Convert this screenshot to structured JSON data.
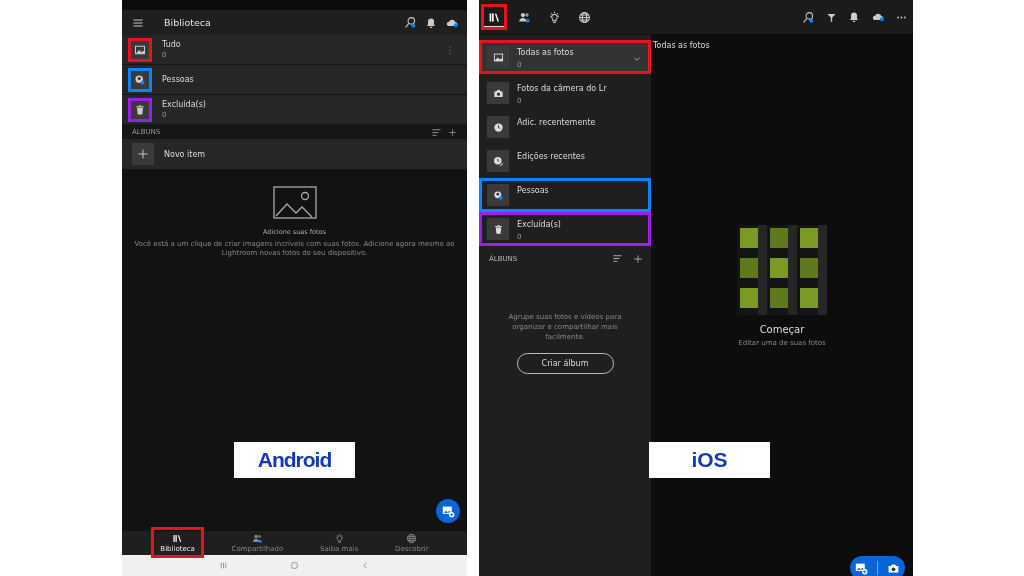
{
  "android": {
    "app_bar": {
      "title": "Biblioteca"
    },
    "items": [
      {
        "kind": "all",
        "label": "Tudo",
        "count": "0",
        "color": "#e8141c"
      },
      {
        "kind": "people",
        "label": "Pessoas",
        "color": "#0a84ff"
      },
      {
        "kind": "deleted",
        "label": "Excluída(s)",
        "count": "0",
        "color": "#9b1fe8"
      }
    ],
    "albums_header": "ÁLBUNS",
    "new_item": "Novo item",
    "empty_state": {
      "title": "Adicione suas fotos",
      "text": "Você está a um clique de criar imagens incríveis com suas fotos. Adicione agora mesmo ao Lightroom novas fotos do seu dispositivo."
    },
    "caption": "Android",
    "bottom_nav": [
      {
        "kind": "library",
        "label": "Biblioteca",
        "selected": true,
        "color": "#e8141c"
      },
      {
        "kind": "shared",
        "label": "Compartilhado",
        "selected": false
      },
      {
        "kind": "learn",
        "label": "Saiba mais",
        "selected": false
      },
      {
        "kind": "discover",
        "label": "Descobrir",
        "selected": false
      }
    ]
  },
  "ios": {
    "tabs": [
      {
        "kind": "library",
        "selected": true,
        "color": "#e8141c"
      },
      {
        "kind": "shared",
        "selected": false
      },
      {
        "kind": "learn",
        "selected": false
      },
      {
        "kind": "discover",
        "selected": false
      }
    ],
    "sidebar": [
      {
        "kind": "all",
        "label": "Todas as fotos",
        "count": "0",
        "selected": true,
        "color": "#e8141c"
      },
      {
        "kind": "camera",
        "label": "Fotos da câmera do Lr",
        "count": "0",
        "selected": false
      },
      {
        "kind": "recent",
        "label": "Adic. recentemente",
        "selected": false
      },
      {
        "kind": "edits",
        "label": "Edições recentes",
        "selected": false
      },
      {
        "kind": "people",
        "label": "Pessoas",
        "selected": false,
        "color": "#0a84ff"
      },
      {
        "kind": "deleted",
        "label": "Excluída(s)",
        "count": "0",
        "selected": false,
        "color": "#9b1fe8"
      }
    ],
    "albums_header": "ÁLBUNS",
    "albums_empty": "Agrupe suas fotos e vídeos para organizar e compartilhar mais facilmente.",
    "create_album": "Criar álbum",
    "main_title": "Todas as fotos",
    "start_title": "Começar",
    "start_subtitle": "Editar uma de suas fotos",
    "caption": "iOS"
  }
}
